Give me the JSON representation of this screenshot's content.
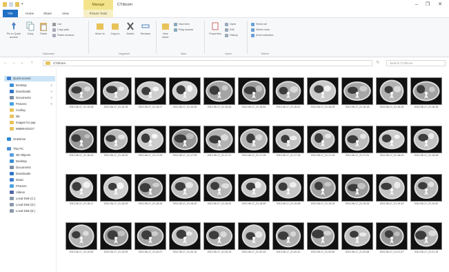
{
  "window": {
    "title": "CTdicom",
    "context_tab": "Manage",
    "controls": {
      "minimize": "–",
      "maximize": "❐",
      "close": "✕"
    }
  },
  "tabs": [
    {
      "label": "File"
    },
    {
      "label": "Home"
    },
    {
      "label": "Share"
    },
    {
      "label": "View"
    },
    {
      "label": "Picture Tools"
    }
  ],
  "ribbon": {
    "clipboard": {
      "group_label": "Clipboard",
      "pin_label": "Pin to Quick access",
      "copy_label": "Copy",
      "paste_label": "Paste",
      "cut_label": "Cut",
      "copy_path_label": "Copy path",
      "paste_shortcut_label": "Paste shortcut"
    },
    "organize": {
      "group_label": "Organize",
      "move_label": "Move to",
      "copy_to_label": "Copy to",
      "delete_label": "Delete",
      "rename_label": "Rename"
    },
    "new": {
      "group_label": "New",
      "new_folder_label": "New folder",
      "new_item_label": "New item",
      "easy_access_label": "Easy access"
    },
    "open": {
      "group_label": "Open",
      "properties_label": "Properties",
      "open_label": "Open",
      "edit_label": "Edit",
      "history_label": "History"
    },
    "select": {
      "group_label": "Select",
      "select_all_label": "Select all",
      "select_none_label": "Select none",
      "invert_label": "Invert selection"
    }
  },
  "address": {
    "path": "CTdicom",
    "search_placeholder": "Search CTdicom"
  },
  "nav": {
    "items": [
      {
        "label": "Quick access",
        "selected": true,
        "color": "#3b7fd6",
        "pinned": false
      },
      {
        "label": "Desktop",
        "selected": false,
        "color": "#3b8fd6",
        "pinned": true
      },
      {
        "label": "Downloads",
        "selected": false,
        "color": "#2f76c9",
        "pinned": true
      },
      {
        "label": "Documents",
        "selected": false,
        "color": "#7c8da3",
        "pinned": true
      },
      {
        "label": "Pictures",
        "selected": false,
        "color": "#4aa3e0",
        "pinned": true
      },
      {
        "label": "Coding",
        "selected": false,
        "color": "#e8c35a",
        "pinned": false
      },
      {
        "label": "lab",
        "selected": false,
        "color": "#e8c35a",
        "pinned": false
      },
      {
        "label": "Images for pap",
        "selected": false,
        "color": "#e8c35a",
        "pinned": false
      },
      {
        "label": "MMWHS2017",
        "selected": false,
        "color": "#e8c35a",
        "pinned": false
      },
      {
        "label": "OneDrive",
        "selected": false,
        "color": "#2b88d8",
        "pinned": false
      },
      {
        "label": "This PC",
        "selected": false,
        "color": "#4a90d9",
        "pinned": false
      },
      {
        "label": "3D Objects",
        "selected": false,
        "color": "#5aa0e0",
        "pinned": false
      },
      {
        "label": "Desktop",
        "selected": false,
        "color": "#3b8fd6",
        "pinned": false
      },
      {
        "label": "Documents",
        "selected": false,
        "color": "#7c8da3",
        "pinned": false
      },
      {
        "label": "Downloads",
        "selected": false,
        "color": "#2f76c9",
        "pinned": false
      },
      {
        "label": "Music",
        "selected": false,
        "color": "#3a7bd5",
        "pinned": false
      },
      {
        "label": "Pictures",
        "selected": false,
        "color": "#4aa3e0",
        "pinned": false
      },
      {
        "label": "Videos",
        "selected": false,
        "color": "#5566aa",
        "pinned": false
      },
      {
        "label": "Local Disk (C:)",
        "selected": false,
        "color": "#8899aa",
        "pinned": false
      },
      {
        "label": "Local Disk (D:)",
        "selected": false,
        "color": "#8899aa",
        "pinned": false
      },
      {
        "label": "Local Disk (E:)",
        "selected": false,
        "color": "#8899aa",
        "pinned": false
      }
    ]
  },
  "files": {
    "rows": [
      [
        {
          "name": "2012-06-17_21-15-08"
        },
        {
          "name": "2012-06-17_21-15-18"
        },
        {
          "name": "2012-06-17_21-15-27"
        },
        {
          "name": "2012-06-17_21-15-36"
        },
        {
          "name": "2012-06-17_21-15-44"
        },
        {
          "name": "2012-06-17_21-15-52"
        },
        {
          "name": "2012-06-17_21-16-01"
        },
        {
          "name": "2012-06-17_21-16-09"
        },
        {
          "name": "2012-06-17_21-16-18"
        },
        {
          "name": "2012-06-17_21-16-26"
        },
        {
          "name": "2012-06-17_21-16-35"
        }
      ],
      [
        {
          "name": "2012-06-17_21-16-43"
        },
        {
          "name": "2012-06-17_21-16-52"
        },
        {
          "name": "2012-06-17_21-17-00"
        },
        {
          "name": "2012-06-17_21-17-09"
        },
        {
          "name": "2012-06-17_21-17-17"
        },
        {
          "name": "2012-06-17_21-17-26"
        },
        {
          "name": "2012-06-17_21-17-34"
        },
        {
          "name": "2012-06-17_21-17-43"
        },
        {
          "name": "2012-06-17_21-17-51"
        },
        {
          "name": "2012-06-17_21-18-00"
        },
        {
          "name": "2012-06-17_21-18-08"
        }
      ],
      [
        {
          "name": "2012-06-17_21-18-17"
        },
        {
          "name": "2012-06-17_21-18-25"
        },
        {
          "name": "2012-06-17_21-18-34"
        },
        {
          "name": "2012-06-17_21-18-42"
        },
        {
          "name": "2012-06-17_21-18-51"
        },
        {
          "name": "2012-06-17_21-18-59"
        },
        {
          "name": "2012-06-17_21-19-08"
        },
        {
          "name": "2012-06-17_21-19-16"
        },
        {
          "name": "2012-06-17_21-19-25"
        },
        {
          "name": "2012-06-17_21-19-33"
        },
        {
          "name": "2012-06-17_21-19-42"
        }
      ],
      [
        {
          "name": "2012-06-17_21-19-50"
        },
        {
          "name": "2012-06-17_21-19-59"
        },
        {
          "name": "2012-06-17_21-20-07"
        },
        {
          "name": "2012-06-17_21-20-16"
        },
        {
          "name": "2012-06-17_21-20-24"
        },
        {
          "name": "2012-06-17_21-20-33"
        },
        {
          "name": "2012-06-17_21-20-41"
        },
        {
          "name": "2012-06-17_21-20-50"
        },
        {
          "name": "2012-06-17_21-20-58"
        },
        {
          "name": "2012-06-17_21-21-07"
        },
        {
          "name": "2012-06-17_21-21-15"
        }
      ]
    ]
  },
  "colors": {
    "file_tab": "#1f6fc5",
    "selection": "#cce4f7",
    "manage_tab": "#f3e48b"
  }
}
